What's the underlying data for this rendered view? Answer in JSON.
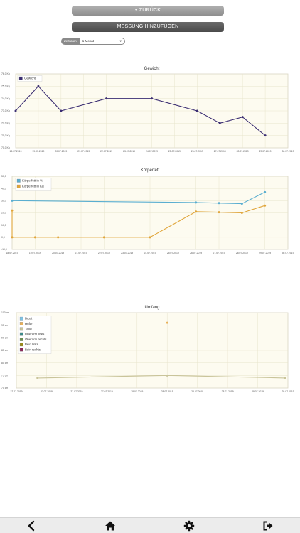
{
  "buttons": {
    "back_label": "▾ ZURÜCK",
    "add_label": "MESSUNG HINZUFÜGEN"
  },
  "zeitraum": {
    "label": "Zeitraum",
    "value": "1 Monat"
  },
  "chart_data": [
    {
      "type": "line",
      "title": "Gewicht",
      "x": [
        "18.07.2019",
        "19.07.2019",
        "20.07.2019",
        "21.07.2019",
        "22.07.2019",
        "23.07.2019",
        "24.07.2019",
        "25.07.2019",
        "26.07.2019",
        "27.07.2019",
        "28.07.2019",
        "29.07.2019",
        "30.07.2019"
      ],
      "y_ticks": [
        "70,0 Kg",
        "71,0 Kg",
        "72,0 Kg",
        "73,0 Kg",
        "74,0 Kg",
        "75,0 Kg",
        "76,0 Kg"
      ],
      "ylim": [
        70,
        76
      ],
      "legend_position": "top-left",
      "series": [
        {
          "name": "Gewicht",
          "color": "#3b2e73",
          "points": [
            [
              0.0,
              73.0
            ],
            [
              1.0,
              75.0
            ],
            [
              2.0,
              73.0
            ],
            [
              4.0,
              74.0
            ],
            [
              6.0,
              74.0
            ],
            [
              8.0,
              73.0
            ],
            [
              9.0,
              72.0
            ],
            [
              10.0,
              72.5
            ],
            [
              11.0,
              71.0
            ]
          ]
        }
      ]
    },
    {
      "type": "line",
      "title": "Körperfett",
      "x": [
        "18.07.2019",
        "19.07.2019",
        "20.07.2019",
        "21.07.2019",
        "22.07.2019",
        "23.07.2019",
        "24.07.2019",
        "25.07.2019",
        "26.07.2019",
        "27.07.2019",
        "28.07.2019",
        "29.07.2019",
        "30.07.2019"
      ],
      "y_ticks": [
        "-10,0",
        "0,0",
        "10,0",
        "20,0",
        "30,0",
        "40,0",
        "50,0"
      ],
      "ylim": [
        -10,
        50
      ],
      "legend_position": "top-left",
      "series": [
        {
          "name": "Körperfett in %",
          "color": "#5aaed0",
          "points": [
            [
              0.0,
              30.0
            ],
            [
              8.0,
              28.5
            ],
            [
              9.0,
              28.0
            ],
            [
              10.0,
              27.5
            ],
            [
              11.0,
              37.0
            ]
          ]
        },
        {
          "name": "Körperfett in Kg",
          "color": "#e0a53a",
          "points": [
            [
              0.0,
              22.0
            ],
            [
              0.0,
              0.0
            ],
            [
              1.0,
              0.0
            ],
            [
              2.0,
              0.0
            ],
            [
              4.0,
              0.0
            ],
            [
              6.0,
              0.0
            ],
            [
              8.0,
              21.0
            ],
            [
              9.0,
              20.5
            ],
            [
              10.0,
              20.0
            ],
            [
              11.0,
              26.0
            ]
          ]
        }
      ]
    },
    {
      "type": "line",
      "title": "Umfang",
      "x": [
        "27.07.2019",
        "27.07.2019",
        "27.07.2019",
        "27.07.2019",
        "28.07.2019",
        "28.07.2019",
        "28.07.2019",
        "28.07.2019",
        "29.07.2019",
        "29.07.2019"
      ],
      "y_ticks": [
        "70 cm",
        "75 cm",
        "80 cm",
        "85 cm",
        "90 cm",
        "95 cm",
        "100 cm"
      ],
      "ylim": [
        70,
        100
      ],
      "legend_position": "top-left",
      "series": [
        {
          "name": "Brust",
          "color": "#7ec3e3",
          "points": []
        },
        {
          "name": "Hüfte",
          "color": "#e8b15a",
          "points": [
            [
              5.0,
              96.0
            ]
          ]
        },
        {
          "name": "Taille",
          "color": "#c9c49a",
          "points": [
            [
              0.7,
              74.0
            ],
            [
              5.0,
              75.0
            ],
            [
              8.9,
              74.0
            ]
          ]
        },
        {
          "name": "Oberarm links",
          "color": "#3b8a8a",
          "points": []
        },
        {
          "name": "Oberarm rechts",
          "color": "#6d8f52",
          "points": []
        },
        {
          "name": "Bein links",
          "color": "#9a8a1a",
          "points": []
        },
        {
          "name": "Bein rechts",
          "color": "#8a2a5a",
          "points": []
        }
      ]
    }
  ],
  "nav": {
    "back_icon": "chevron-left-icon",
    "home_icon": "home-icon",
    "settings_icon": "gear-icon",
    "logout_icon": "logout-icon"
  }
}
